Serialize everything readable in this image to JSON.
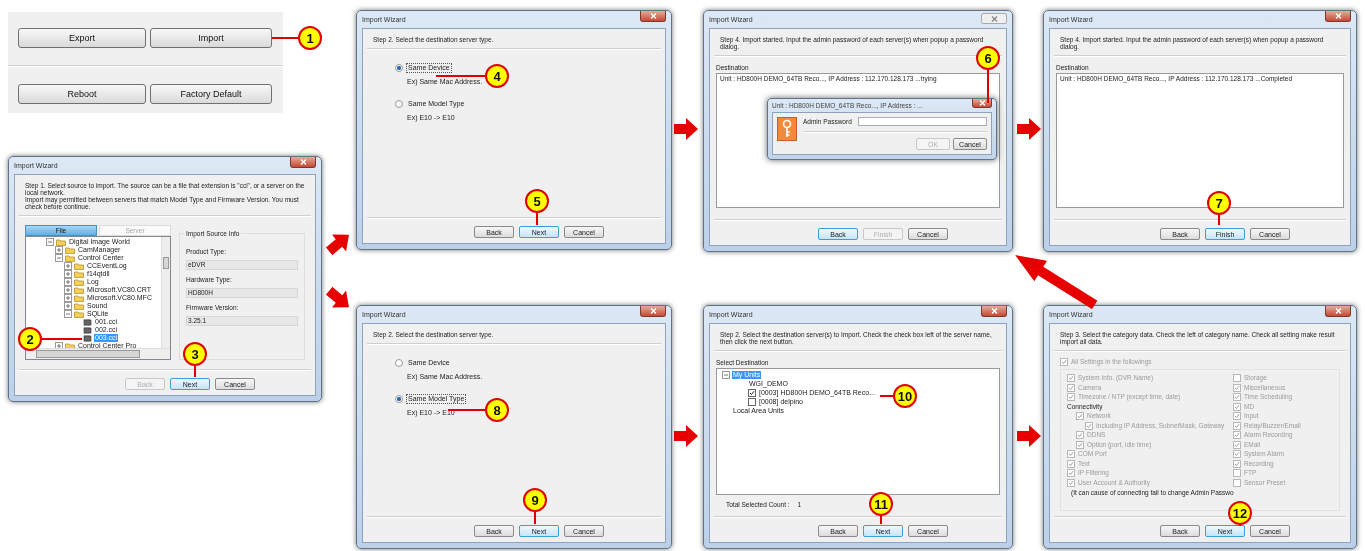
{
  "button_panel": {
    "rows": [
      [
        {
          "label": "Export"
        },
        {
          "label": "Import"
        }
      ],
      [
        {
          "label": "Reboot"
        },
        {
          "label": "Factory Default"
        }
      ]
    ]
  },
  "dialogs": [
    {
      "kind": "source",
      "title": "Import Wizard",
      "active": true,
      "instructions": [
        "Step 1. Select source to import. The source can be a file that extension is \"cci\", or a server on the local network.",
        "Import may permitted between servers that match Model Type and Firmware Version. You must check before continue."
      ],
      "tabs": [
        {
          "label": "File",
          "selected": true
        },
        {
          "label": "Server",
          "selected": false
        }
      ],
      "tree": [
        {
          "label": "Digital Image World",
          "kind": "folder",
          "expanded": true,
          "selected": false,
          "children": [
            {
              "label": "CamManager",
              "kind": "folder",
              "expanded": false,
              "selected": false
            },
            {
              "label": "Control Center",
              "kind": "folder",
              "expanded": true,
              "selected": false,
              "children": [
                {
                  "label": "CCEventLog",
                  "kind": "folder",
                  "expanded": false,
                  "selected": false
                },
                {
                  "label": "f14qtdll",
                  "kind": "folder",
                  "expanded": false,
                  "selected": false
                },
                {
                  "label": "Log",
                  "kind": "folder",
                  "expanded": false,
                  "selected": false
                },
                {
                  "label": "Microsoft.VC80.CRT",
                  "kind": "folder",
                  "expanded": false,
                  "selected": false
                },
                {
                  "label": "Microsoft.VC80.MFC",
                  "kind": "folder",
                  "expanded": false,
                  "selected": false
                },
                {
                  "label": "Sound",
                  "kind": "folder",
                  "expanded": false,
                  "selected": false
                },
                {
                  "label": "SQLite",
                  "kind": "folder",
                  "expanded": true,
                  "selected": false,
                  "children": [
                    {
                      "label": "001.cci",
                      "kind": "file",
                      "selected": false
                    },
                    {
                      "label": "002.cci",
                      "kind": "file",
                      "selected": false
                    },
                    {
                      "label": "003.cci",
                      "kind": "file",
                      "selected": true
                    }
                  ]
                }
              ]
            },
            {
              "label": "Control Center Pro",
              "kind": "folder",
              "expanded": false,
              "selected": false
            }
          ]
        }
      ],
      "info": {
        "title": "Import Source Info",
        "fields": [
          {
            "label": "Product Type:",
            "value": "eDVR"
          },
          {
            "label": "Hardware Type:",
            "value": "HD800H"
          },
          {
            "label": "Firmware Version:",
            "value": "3.25.1"
          }
        ]
      },
      "buttons": [
        {
          "label": "Back",
          "disabled": true,
          "focused": false
        },
        {
          "label": "Next",
          "disabled": false,
          "focused": true
        },
        {
          "label": "Cancel",
          "disabled": false,
          "focused": false
        }
      ]
    },
    {
      "kind": "server_type",
      "title": "Import Wizard",
      "active": true,
      "instructions": [
        "Step 2. Select the destination server type."
      ],
      "options": [
        {
          "label": "Same Device",
          "description": "Ex) Same Mac Address.",
          "selected": true
        },
        {
          "label": "Same Model Type",
          "description": "Ex) E10 -> E10",
          "selected": false
        }
      ],
      "buttons": [
        {
          "label": "Back",
          "disabled": false,
          "focused": false
        },
        {
          "label": "Next",
          "disabled": false,
          "focused": true
        },
        {
          "label": "Cancel",
          "disabled": false,
          "focused": false
        }
      ]
    },
    {
      "kind": "progress",
      "title": "Import Wizard",
      "active": false,
      "instructions": [
        "Step 4. Import started. Input the admin password of each server(s) when popup a password dialog."
      ],
      "list_label": "Destination",
      "log": [
        "Unit : HD800H DEMO_64TB Reco..., IP Address : 112.170.128.173 ...trying"
      ],
      "popup": {
        "title": "Unit : HD800H DEMO_64TB Reco..., IP Address : ...",
        "field_label": "Admin Password",
        "buttons": [
          {
            "label": "OK",
            "disabled": true,
            "focused": false
          },
          {
            "label": "Cancel",
            "disabled": false,
            "focused": false
          }
        ]
      },
      "buttons": [
        {
          "label": "Back",
          "disabled": false,
          "focused": true
        },
        {
          "label": "Finish",
          "disabled": true,
          "focused": false
        },
        {
          "label": "Cancel",
          "disabled": false,
          "focused": false
        }
      ]
    },
    {
      "kind": "progress",
      "title": "Import Wizard",
      "active": true,
      "instructions": [
        "Step 4. Import started. Input the admin password of each server(s) when popup a password dialog."
      ],
      "list_label": "Destination",
      "log": [
        "Unit : HD800H DEMO_64TB Reco..., IP Address : 112.170.128.173 ...Completed"
      ],
      "buttons": [
        {
          "label": "Back",
          "disabled": false,
          "focused": false
        },
        {
          "label": "Finish",
          "disabled": false,
          "focused": true
        },
        {
          "label": "Cancel",
          "disabled": false,
          "focused": false
        }
      ]
    },
    {
      "kind": "server_type",
      "title": "Import Wizard",
      "active": true,
      "instructions": [
        "Step 2. Select the destination server type."
      ],
      "options": [
        {
          "label": "Same Device",
          "description": "Ex) Same Mac Address.",
          "selected": false
        },
        {
          "label": "Same Model Type",
          "description": "Ex) E10 -> E10",
          "selected": true
        }
      ],
      "buttons": [
        {
          "label": "Back",
          "disabled": false,
          "focused": false
        },
        {
          "label": "Next",
          "disabled": false,
          "focused": true
        },
        {
          "label": "Cancel",
          "disabled": false,
          "focused": false
        }
      ]
    },
    {
      "kind": "destination",
      "title": "Import Wizard",
      "active": true,
      "instructions": [
        "Step 2. Select the destination server(s) to Import. Check the check box left of the server name, then click the next button."
      ],
      "list_label": "Select Destination",
      "tree": [
        {
          "label": "My Units",
          "kind": "root",
          "expanded": true,
          "selected": true,
          "children": [
            {
              "label": "WGI_DEMO",
              "kind": "group",
              "selected": false
            },
            {
              "label": "[0003] HD800H DEMO_64TB Reco...",
              "kind": "unit",
              "checked": true,
              "selected": false
            },
            {
              "label": "[0008] delpino",
              "kind": "unit",
              "checked": false,
              "selected": false
            }
          ]
        },
        {
          "label": "Local Area Units",
          "kind": "root",
          "selected": false
        }
      ],
      "count_label": "Total Selected Count :",
      "count_value": "1",
      "buttons": [
        {
          "label": "Back",
          "disabled": false,
          "focused": false
        },
        {
          "label": "Next",
          "disabled": false,
          "focused": true
        },
        {
          "label": "Cancel",
          "disabled": false,
          "focused": false
        }
      ]
    },
    {
      "kind": "categories",
      "title": "Import Wizard",
      "active": true,
      "instructions": [
        "Step 3. Select the category data. Check the left of category name. Check all setting make result import all data."
      ],
      "all_settings": {
        "label": "All Settings in the followings",
        "checked": true
      },
      "disabled": true,
      "columns": [
        [
          {
            "kind": "check",
            "label": "System Info. (DVR Name)",
            "checked": true
          },
          {
            "kind": "check",
            "label": "Camera",
            "checked": true
          },
          {
            "kind": "check",
            "label": "Timezone / NTP (except time, date)",
            "checked": true
          },
          {
            "kind": "heading",
            "label": "Connectivity",
            "children": [
              {
                "kind": "check",
                "label": "Network",
                "checked": true,
                "children": [
                  {
                    "kind": "check",
                    "label": "Including IP Address, SubnetMask, Gateway",
                    "checked": true
                  }
                ]
              },
              {
                "kind": "check",
                "label": "DDNS",
                "checked": true
              },
              {
                "kind": "check",
                "label": "Option (port, idle time)",
                "checked": true
              }
            ]
          },
          {
            "kind": "check",
            "label": "COM Port",
            "checked": true
          },
          {
            "kind": "check",
            "label": "Text",
            "checked": true
          },
          {
            "kind": "check",
            "label": "IP Filtering",
            "checked": true
          },
          {
            "kind": "check",
            "label": "User Account & Authority",
            "checked": true
          }
        ],
        [
          {
            "kind": "check",
            "label": "Storage",
            "checked": false
          },
          {
            "kind": "check",
            "label": "Miscellaneous",
            "checked": true
          },
          {
            "kind": "check",
            "label": "Time Scheduling",
            "checked": true
          },
          {
            "kind": "check",
            "label": "MD",
            "checked": true
          },
          {
            "kind": "check",
            "label": "Input",
            "checked": true
          },
          {
            "kind": "check",
            "label": "Relay/Buzzer/Email",
            "checked": true
          },
          {
            "kind": "check",
            "label": "Alarm Recording",
            "checked": true
          },
          {
            "kind": "check",
            "label": "EMail",
            "checked": true
          },
          {
            "kind": "check",
            "label": "System Alarm",
            "checked": true
          },
          {
            "kind": "check",
            "label": "Recording",
            "checked": true
          },
          {
            "kind": "check",
            "label": "FTP",
            "checked": false
          },
          {
            "kind": "check",
            "label": "Sensor Preset",
            "checked": false
          }
        ]
      ],
      "note": "(It can cause of connecting fail to change Admin Passwo",
      "buttons": [
        {
          "label": "Back",
          "disabled": false,
          "focused": false
        },
        {
          "label": "Next",
          "disabled": false,
          "focused": true
        },
        {
          "label": "Cancel",
          "disabled": false,
          "focused": false
        }
      ]
    }
  ],
  "callouts": [
    {
      "label": "1"
    },
    {
      "label": "2"
    },
    {
      "label": "3"
    },
    {
      "label": "4"
    },
    {
      "label": "5"
    },
    {
      "label": "6"
    },
    {
      "label": "7"
    },
    {
      "label": "8"
    },
    {
      "label": "9"
    },
    {
      "label": "10"
    },
    {
      "label": "11"
    },
    {
      "label": "12"
    }
  ]
}
